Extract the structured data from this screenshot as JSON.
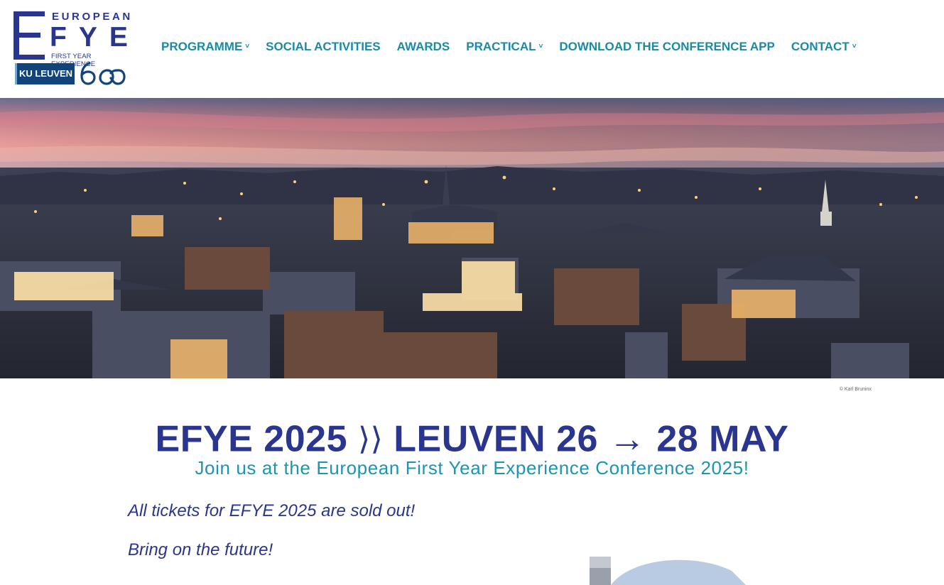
{
  "logo": {
    "letter_e": "E",
    "word_european": "EUROPEAN",
    "word_fye": "FYE",
    "subtitle": "FIRST YEAR EXPERIENCE",
    "partner": "KU LEUVEN",
    "anniversary": "600"
  },
  "nav": {
    "items": [
      {
        "label": "PROGRAMME",
        "has_dropdown": true
      },
      {
        "label": "SOCIAL ACTIVITIES",
        "has_dropdown": false
      },
      {
        "label": "AWARDS",
        "has_dropdown": false
      },
      {
        "label": "PRACTICAL",
        "has_dropdown": true
      },
      {
        "label": "DOWNLOAD THE CONFERENCE APP",
        "has_dropdown": false
      },
      {
        "label": "CONTACT",
        "has_dropdown": true
      }
    ],
    "dropdown_glyph": "˅"
  },
  "hero": {
    "description_icon": "leuven-skyline-photo",
    "credit": "© Karl Bruninx"
  },
  "headline": {
    "part1": "EFYE 2025",
    "separator": "⟩⟩",
    "part2": "LEUVEN 26",
    "arrow": "→",
    "part3": "28 MAY"
  },
  "subline": "Join us at the European First Year Experience Conference 2025!",
  "content": {
    "notice": "All tickets for EFYE 2025 are sold out!",
    "tagline": "Bring on the future!"
  },
  "colors": {
    "brand_navy": "#2a3590",
    "nav_teal": "#1a8aa6",
    "sub_teal": "#1a96b0",
    "kul_blue": "#12447a"
  }
}
